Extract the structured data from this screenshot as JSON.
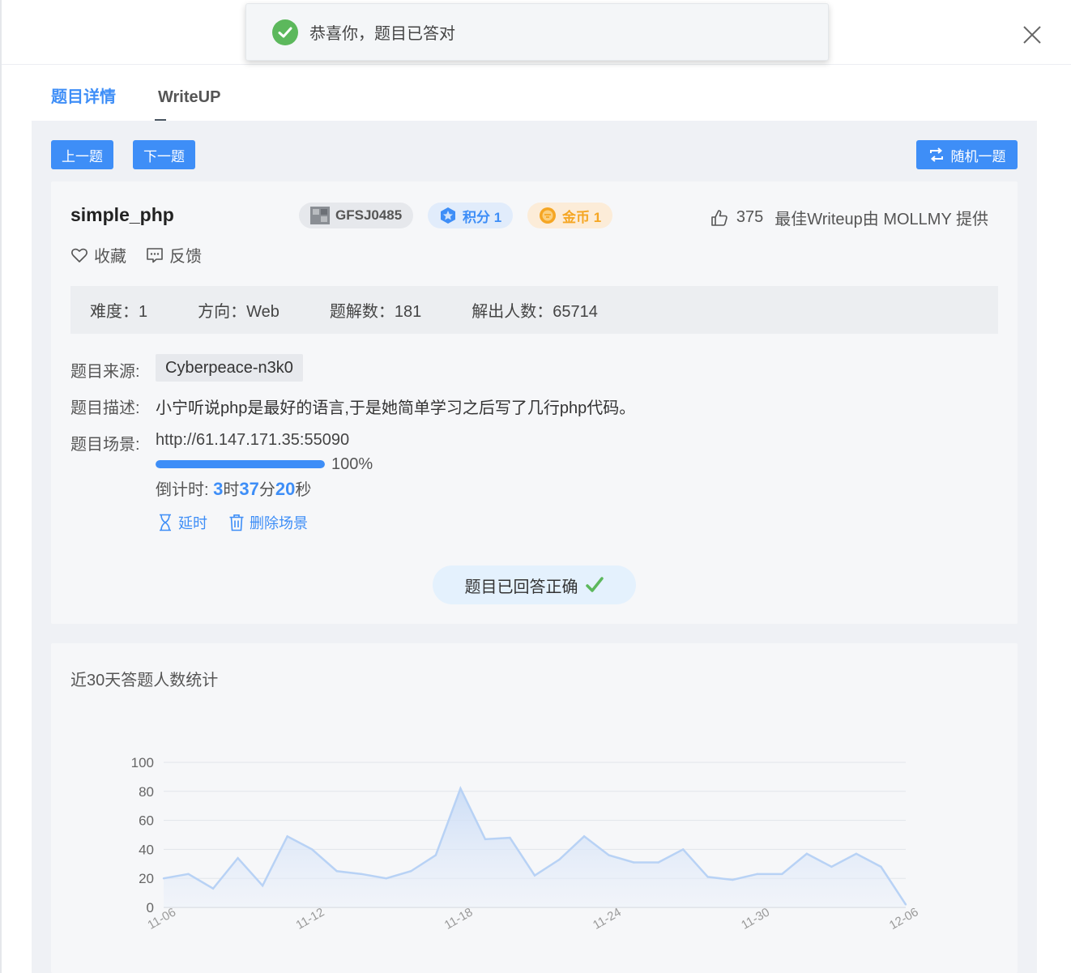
{
  "toast": {
    "message": "恭喜你，题目已答对"
  },
  "tabs": [
    {
      "label": "题目详情"
    },
    {
      "label": "WriteUP"
    }
  ],
  "nav": {
    "prev": "上一题",
    "next": "下一题",
    "random": "随机一题"
  },
  "challenge": {
    "name": "simple_php",
    "id_badge": "GFSJ0485",
    "score_badge": "积分 1",
    "coin_badge": "金币 1",
    "likes": "375",
    "best_writeup": "最佳Writeup由 MOLLMY 提供",
    "favorite": "收藏",
    "feedback": "反馈",
    "stats": {
      "difficulty": "难度：1",
      "direction": "方向：Web",
      "solves": "题解数：181",
      "solvers": "解出人数：65714"
    },
    "source_label": "题目来源:",
    "source": "Cyberpeace-n3k0",
    "desc_label": "题目描述:",
    "description": "小宁听说php是最好的语言,于是她简单学习之后写了几行php代码。",
    "scene_label": "题目场景:",
    "scene_url": "http://61.147.171.35:55090",
    "progress_text": "100%",
    "progress": 1.0,
    "countdown_label": "倒计时: ",
    "countdown": {
      "h": "3",
      "h_unit": "时",
      "m": "37",
      "m_unit": "分",
      "s": "20",
      "s_unit": "秒"
    },
    "extend": "延时",
    "delete_scene": "删除场景",
    "answered": "题目已回答正确"
  },
  "colors": {
    "accent": "#3e8ef7",
    "success": "#5cb85c",
    "coin": "#f5a623"
  },
  "chart_section_title": "近30天答题人数统计",
  "chart_data": {
    "type": "area",
    "title": "",
    "xlabel": "",
    "ylabel": "",
    "ylim": [
      0,
      100
    ],
    "yticks": [
      0,
      20,
      40,
      60,
      80,
      100
    ],
    "xtick_labels": [
      "11-06",
      "11-12",
      "11-18",
      "11-24",
      "11-30",
      "12-06"
    ],
    "x": [
      "11-06",
      "11-07",
      "11-08",
      "11-09",
      "11-10",
      "11-11",
      "11-12",
      "11-13",
      "11-14",
      "11-15",
      "11-16",
      "11-17",
      "11-18",
      "11-19",
      "11-20",
      "11-21",
      "11-22",
      "11-23",
      "11-24",
      "11-25",
      "11-26",
      "11-27",
      "11-28",
      "11-29",
      "11-30",
      "12-01",
      "12-02",
      "12-03",
      "12-04",
      "12-05",
      "12-06"
    ],
    "values": [
      20,
      23,
      13,
      34,
      15,
      49,
      40,
      25,
      23,
      20,
      25,
      36,
      82,
      47,
      48,
      22,
      33,
      49,
      36,
      31,
      31,
      40,
      21,
      19,
      23,
      23,
      37,
      28,
      37,
      28,
      2
    ],
    "grid": true,
    "legend": "none"
  }
}
